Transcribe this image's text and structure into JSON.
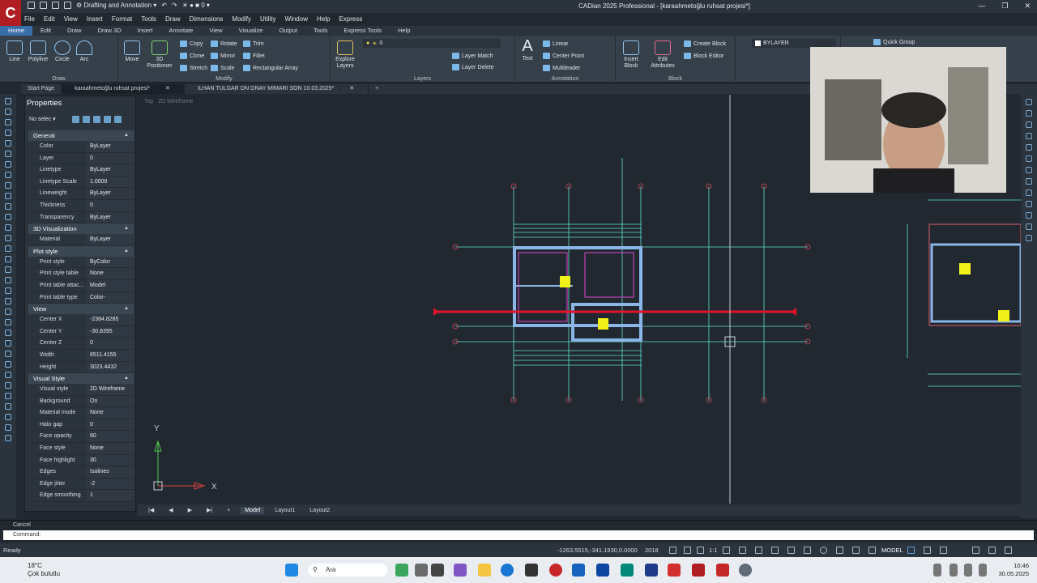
{
  "app": {
    "title": "CADian 2025 Professional - [karaahmetoğlu ruhsat projesi*]",
    "workspace": "Drafting and Annotation",
    "logo_letter": "C",
    "layer_quick": "0"
  },
  "menu": [
    "File",
    "Edit",
    "View",
    "Insert",
    "Format",
    "Tools",
    "Draw",
    "Dimensions",
    "Modify",
    "Utility",
    "Window",
    "Help",
    "Express"
  ],
  "ribbon_tabs": [
    "Home",
    "Edit",
    "Draw",
    "Draw 3D",
    "Insert",
    "Annotate",
    "View",
    "Visualize",
    "Output",
    "Tools",
    "Express Tools",
    "Help"
  ],
  "ribbon": {
    "draw": {
      "label": "Draw",
      "line": "Line",
      "polyline": "Polyline",
      "circle": "Circle",
      "arc": "Arc"
    },
    "modify": {
      "label": "Modify",
      "move": "Move",
      "positioner_1": "3D",
      "positioner_2": "Positioner",
      "copy": "Copy",
      "clone": "Clone",
      "stretch": "Stretch",
      "rotate": "Rotate",
      "mirror": "Mirror",
      "scale": "Scale",
      "trim": "Trim",
      "fillet": "Fillet",
      "rect_array": "Rectangular Array"
    },
    "layers": {
      "label": "Layers",
      "explore_1": "Explore",
      "explore_2": "Layers",
      "layer_value": "0",
      "layer_match": "Layer Match",
      "layer_delete": "Layer Delete"
    },
    "annotation": {
      "label": "Annotation",
      "text": "Text",
      "linear": "Linear",
      "center_point": "Center Point",
      "multileader": "Multileader"
    },
    "block": {
      "label": "Block",
      "insert_1": "Insert",
      "insert_2": "Block",
      "edit_1": "Edit",
      "edit_2": "Attributes",
      "create": "Create Block",
      "editor": "Block Editor"
    },
    "properties": {
      "bylayer": "BYLAYER",
      "quick_group": "Quick Group"
    }
  },
  "doc_tabs": [
    "Start Page",
    "karaahmetoğlu ruhsat projesi*",
    "ILHAN TULGAR ON ONAY MIMARI SON 10.03.2025*"
  ],
  "properties": {
    "title": "Properties",
    "selection": "No selec",
    "sections": [
      {
        "name": "General",
        "rows": [
          [
            "Color",
            "ByLayer"
          ],
          [
            "Layer",
            "0"
          ],
          [
            "Linetype",
            "ByLayer"
          ],
          [
            "Linetype Scale",
            "1.0000"
          ],
          [
            "Lineweight",
            "ByLayer"
          ],
          [
            "Thickness",
            "0"
          ],
          [
            "Transparency",
            "ByLayer"
          ]
        ]
      },
      {
        "name": "3D Visualization",
        "rows": [
          [
            "Material",
            "ByLayer"
          ]
        ]
      },
      {
        "name": "Plot style",
        "rows": [
          [
            "Print style",
            "ByColor"
          ],
          [
            "Print style table",
            "None"
          ],
          [
            "Print table attac...",
            "Model"
          ],
          [
            "Print table type",
            "Color-dependen..."
          ]
        ]
      },
      {
        "name": "View",
        "rows": [
          [
            "Center X",
            "-2384.8285"
          ],
          [
            "Center Y",
            "-30.8395"
          ],
          [
            "Center Z",
            "0"
          ],
          [
            "Width",
            "6511.4155"
          ],
          [
            "Height",
            "3023.4432"
          ]
        ]
      },
      {
        "name": "Visual Style",
        "rows": [
          [
            "Visual style",
            "2D Wireframe"
          ],
          [
            "Background",
            "On"
          ],
          [
            "Material mode",
            "None"
          ],
          [
            "Halo gap",
            "0"
          ],
          [
            "Face opacity",
            "60"
          ],
          [
            "Face style",
            "None"
          ],
          [
            "Face highlight",
            "30"
          ],
          [
            "Edges",
            "Isolines"
          ],
          [
            "Edge jitter",
            "-2"
          ],
          [
            "Edge smoothing",
            "1"
          ]
        ]
      }
    ]
  },
  "viewport": {
    "view": "Top",
    "style": "2D Wireframe",
    "axis_x": "X",
    "axis_y": "Y"
  },
  "layout_tabs": [
    "Model",
    "Layout1",
    "Layout2"
  ],
  "command": {
    "history": "Cancel",
    "prompt": "Command:"
  },
  "status": {
    "state": "Ready",
    "coords": "-1263.5515,-341.1930,0.0000",
    "year": "2018",
    "scale": "1:1",
    "mode": "MODEL"
  },
  "taskbar": {
    "temp": "18°C",
    "weather": "Çok bulutlu",
    "search": "Ara",
    "time": "10:46",
    "date": "30.05.2025"
  },
  "colors": {
    "accent": "#3a6ea8",
    "background": "#212830",
    "panel": "#2b333d",
    "red_line": "#e0142a",
    "cyan": "#5fe0d0",
    "wall": "#8ab6e8",
    "yellow": "#f2f21a"
  }
}
